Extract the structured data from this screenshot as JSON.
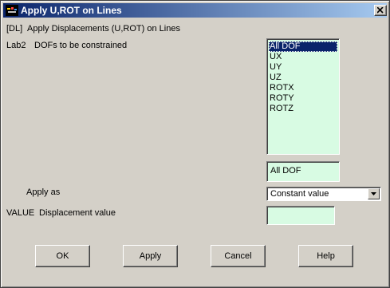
{
  "window": {
    "title": "Apply U,ROT on Lines"
  },
  "header": {
    "command": "[DL]",
    "description": "Apply Displacements (U,ROT) on Lines"
  },
  "lab2": {
    "code": "Lab2",
    "label": "DOFs to be constrained",
    "options": [
      "All DOF",
      "UX",
      "UY",
      "UZ",
      "ROTX",
      "ROTY",
      "ROTZ"
    ],
    "selected": "All DOF"
  },
  "apply_as": {
    "label": "Apply as",
    "value": "Constant value"
  },
  "value_field": {
    "code": "VALUE",
    "label": "Displacement value",
    "value": ""
  },
  "buttons": {
    "ok": "OK",
    "apply": "Apply",
    "cancel": "Cancel",
    "help": "Help"
  },
  "colors": {
    "title_start": "#0a246a",
    "title_end": "#a6caf0",
    "field_bg": "#d8fbe3",
    "dialog_bg": "#d4d0c8"
  }
}
